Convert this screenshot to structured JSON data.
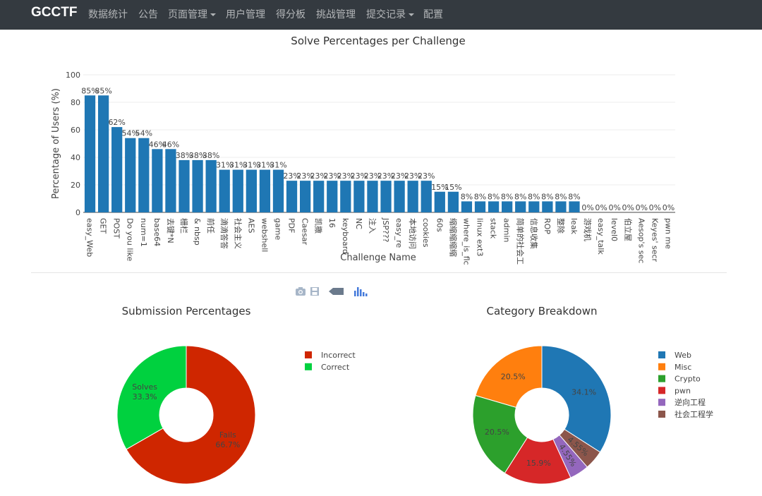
{
  "nav": {
    "brand": "GCCTF",
    "items": [
      {
        "label": "数据统计",
        "dropdown": false
      },
      {
        "label": "公告",
        "dropdown": false
      },
      {
        "label": "页面管理",
        "dropdown": true
      },
      {
        "label": "用户管理",
        "dropdown": false
      },
      {
        "label": "得分板",
        "dropdown": false
      },
      {
        "label": "挑战管理",
        "dropdown": false
      },
      {
        "label": "提交记录",
        "dropdown": true
      },
      {
        "label": "配置",
        "dropdown": false
      }
    ]
  },
  "modebar": [
    "camera-icon",
    "save-icon",
    "tag-icon",
    "plotly-logo-icon"
  ],
  "chart_data": [
    {
      "type": "bar",
      "title": "Solve Percentages per Challenge",
      "xlabel": "Challenge Name",
      "ylabel": "Percentage of Users (%)",
      "ylim": [
        0,
        100
      ],
      "yticks": [
        0,
        20,
        40,
        60,
        80,
        100
      ],
      "color": "#1f77b4",
      "categories": [
        "easy_Web",
        "GET",
        "POST",
        "Do you like",
        "num=1",
        "base64",
        "去键*N",
        "栅栏",
        "& nbsp",
        "前任",
        "滴滴答答",
        "社会主义",
        "AES",
        "webshell",
        "game",
        "PDF",
        "Caesar",
        "凯撒",
        "16",
        "keyboard",
        "NC",
        "注入",
        "JSP???",
        "easy_re",
        "本地访问",
        "cookies",
        "60s",
        "缩缩缩缩缩",
        "where_is_flc",
        "linux ext3",
        "stack",
        "admin",
        "简单的社会工",
        "信息收集",
        "ROP",
        "整除",
        "leak",
        "游戏机",
        "easy_talk",
        "level0",
        "伯立屋",
        "Aesop's sec",
        "Keyes' secr",
        "pwn me"
      ],
      "values": [
        85,
        85,
        62,
        54,
        54,
        46,
        46,
        38,
        38,
        38,
        31,
        31,
        31,
        31,
        31,
        23,
        23,
        23,
        23,
        23,
        23,
        23,
        23,
        23,
        23,
        23,
        15,
        15,
        8,
        8,
        8,
        8,
        8,
        8,
        8,
        8,
        8,
        0,
        0,
        0,
        0,
        0,
        0,
        0
      ],
      "labels": [
        "85%",
        "85%",
        "62%",
        "54%",
        "54%",
        "46%",
        "46%",
        "38%",
        "38%",
        "38%",
        "31%",
        "31%",
        "31%",
        "31%",
        "31%",
        "23%",
        "23%",
        "23%",
        "23%",
        "23%",
        "23%",
        "23%",
        "23%",
        "23%",
        "23%",
        "23%",
        "15%",
        "15%",
        "8%",
        "8%",
        "8%",
        "8%",
        "8%",
        "8%",
        "8%",
        "8%",
        "8%",
        "0%",
        "0%",
        "0%",
        "0%",
        "0%",
        "0%",
        "0%"
      ]
    },
    {
      "type": "pie",
      "title": "Submission Percentages",
      "hole": true,
      "slices": [
        {
          "name": "Incorrect",
          "text": "Fails",
          "value": 66.7,
          "label": "66.7%",
          "color": "#cf2600"
        },
        {
          "name": "Correct",
          "text": "Solves",
          "value": 33.3,
          "label": "33.3%",
          "color": "#00d13f"
        }
      ]
    },
    {
      "type": "pie",
      "title": "Category Breakdown",
      "hole": true,
      "slices": [
        {
          "name": "Web",
          "value": 34.1,
          "label": "34.1%",
          "color": "#1f77b4"
        },
        {
          "name": "Misc",
          "value": 20.5,
          "label": "20.5%",
          "color": "#ff7f0e"
        },
        {
          "name": "Crypto",
          "value": 20.5,
          "label": "20.5%",
          "color": "#2ca02c"
        },
        {
          "name": "pwn",
          "value": 15.9,
          "label": "15.9%",
          "color": "#d62728"
        },
        {
          "name": "逆向工程",
          "value": 4.55,
          "label": "4.55%",
          "color": "#9467bd"
        },
        {
          "name": "社会工程学",
          "value": 4.55,
          "label": "4.55%",
          "color": "#8c564b"
        }
      ],
      "slice_order": [
        0,
        5,
        4,
        3,
        2,
        1
      ]
    }
  ]
}
